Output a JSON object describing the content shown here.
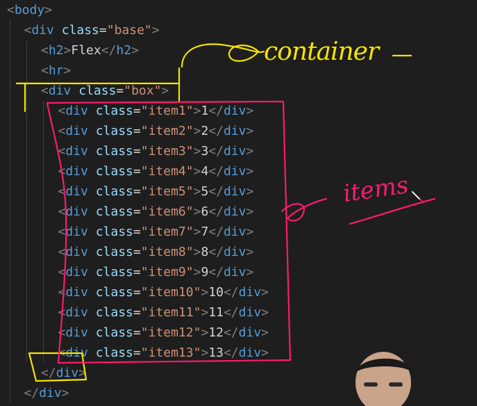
{
  "code": {
    "lines": [
      {
        "indent": 0,
        "kind": "open",
        "tag": "body"
      },
      {
        "indent": 1,
        "kind": "open",
        "tag": "div",
        "attr": "class",
        "value": "base"
      },
      {
        "indent": 2,
        "kind": "inline",
        "tag": "h2",
        "text": "Flex"
      },
      {
        "indent": 2,
        "kind": "open",
        "tag": "hr"
      },
      {
        "indent": 2,
        "kind": "open",
        "tag": "div",
        "attr": "class",
        "value": "box"
      },
      {
        "indent": 3,
        "kind": "item",
        "tag": "div",
        "attr": "class",
        "value": "item1",
        "text": "1"
      },
      {
        "indent": 3,
        "kind": "item",
        "tag": "div",
        "attr": "class",
        "value": "item2",
        "text": "2"
      },
      {
        "indent": 3,
        "kind": "item",
        "tag": "div",
        "attr": "class",
        "value": "item3",
        "text": "3"
      },
      {
        "indent": 3,
        "kind": "item",
        "tag": "div",
        "attr": "class",
        "value": "item4",
        "text": "4"
      },
      {
        "indent": 3,
        "kind": "item",
        "tag": "div",
        "attr": "class",
        "value": "item5",
        "text": "5"
      },
      {
        "indent": 3,
        "kind": "item",
        "tag": "div",
        "attr": "class",
        "value": "item6",
        "text": "6"
      },
      {
        "indent": 3,
        "kind": "item",
        "tag": "div",
        "attr": "class",
        "value": "item7",
        "text": "7"
      },
      {
        "indent": 3,
        "kind": "item",
        "tag": "div",
        "attr": "class",
        "value": "item8",
        "text": "8"
      },
      {
        "indent": 3,
        "kind": "item",
        "tag": "div",
        "attr": "class",
        "value": "item9",
        "text": "9"
      },
      {
        "indent": 3,
        "kind": "item",
        "tag": "div",
        "attr": "class",
        "value": "item10",
        "text": "10"
      },
      {
        "indent": 3,
        "kind": "item",
        "tag": "div",
        "attr": "class",
        "value": "item11",
        "text": "11"
      },
      {
        "indent": 3,
        "kind": "item",
        "tag": "div",
        "attr": "class",
        "value": "item12",
        "text": "12"
      },
      {
        "indent": 3,
        "kind": "item",
        "tag": "div",
        "attr": "class",
        "value": "item13",
        "text": "13"
      },
      {
        "indent": 2,
        "kind": "close",
        "tag": "div"
      },
      {
        "indent": 1,
        "kind": "close",
        "tag": "div"
      }
    ]
  },
  "annotations": {
    "container_note": "container",
    "items_note": "items",
    "yellow": "#f5e400",
    "pink": "#ff1a6e"
  },
  "theme": {
    "tag": "#569cd6",
    "punctuation": "#808080",
    "attribute": "#9cdcfe",
    "string": "#ce9178",
    "text": "#d4d4d4",
    "background": "#1e1e1e"
  }
}
